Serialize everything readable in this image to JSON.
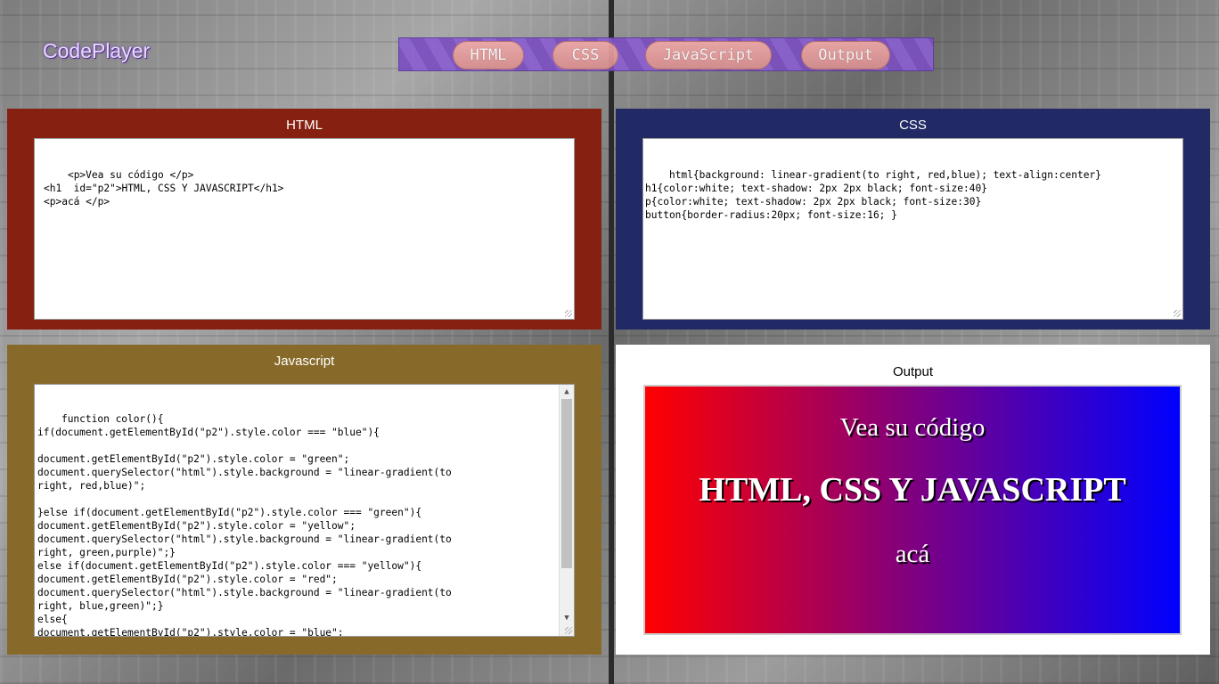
{
  "app": {
    "logo": "CodePlayer"
  },
  "toolbar": {
    "buttons": [
      {
        "label": "HTML"
      },
      {
        "label": "CSS"
      },
      {
        "label": "JavaScript"
      },
      {
        "label": "Output"
      }
    ]
  },
  "panels": {
    "html": {
      "title": "HTML",
      "color": "#862010",
      "code": "<p>Vea su código </p>\n<h1  id=\"p2\">HTML, CSS Y JAVASCRIPT</h1>\n<p>acá </p>"
    },
    "css": {
      "title": "CSS",
      "color": "#222a66",
      "code": "html{background: linear-gradient(to right, red,blue); text-align:center}\nh1{color:white; text-shadow: 2px 2px black; font-size:40}\np{color:white; text-shadow: 2px 2px black; font-size:30}\nbutton{border-radius:20px; font-size:16; }"
    },
    "javascript": {
      "title": "Javascript",
      "color": "#876a2a",
      "code": "function color(){\nif(document.getElementById(\"p2\").style.color === \"blue\"){\n\ndocument.getElementById(\"p2\").style.color = \"green\";\ndocument.querySelector(\"html\").style.background = \"linear-gradient(to\nright, red,blue)\";\n\n}else if(document.getElementById(\"p2\").style.color === \"green\"){\ndocument.getElementById(\"p2\").style.color = \"yellow\";\ndocument.querySelector(\"html\").style.background = \"linear-gradient(to\nright, green,purple)\";}\nelse if(document.getElementById(\"p2\").style.color === \"yellow\"){\ndocument.getElementById(\"p2\").style.color = \"red\";\ndocument.querySelector(\"html\").style.background = \"linear-gradient(to\nright, blue,green)\";}\nelse{\ndocument.getElementById(\"p2\").style.color = \"blue\";\ndocument.querySelector(\"html\").style.background = \"linear-gradient(to"
    },
    "output": {
      "title": "Output",
      "p1": "Vea su código",
      "h1": "HTML, CSS Y JAVASCRIPT",
      "p2": "acá"
    }
  },
  "icons": {
    "scroll_up": "▲",
    "scroll_down": "▼"
  }
}
